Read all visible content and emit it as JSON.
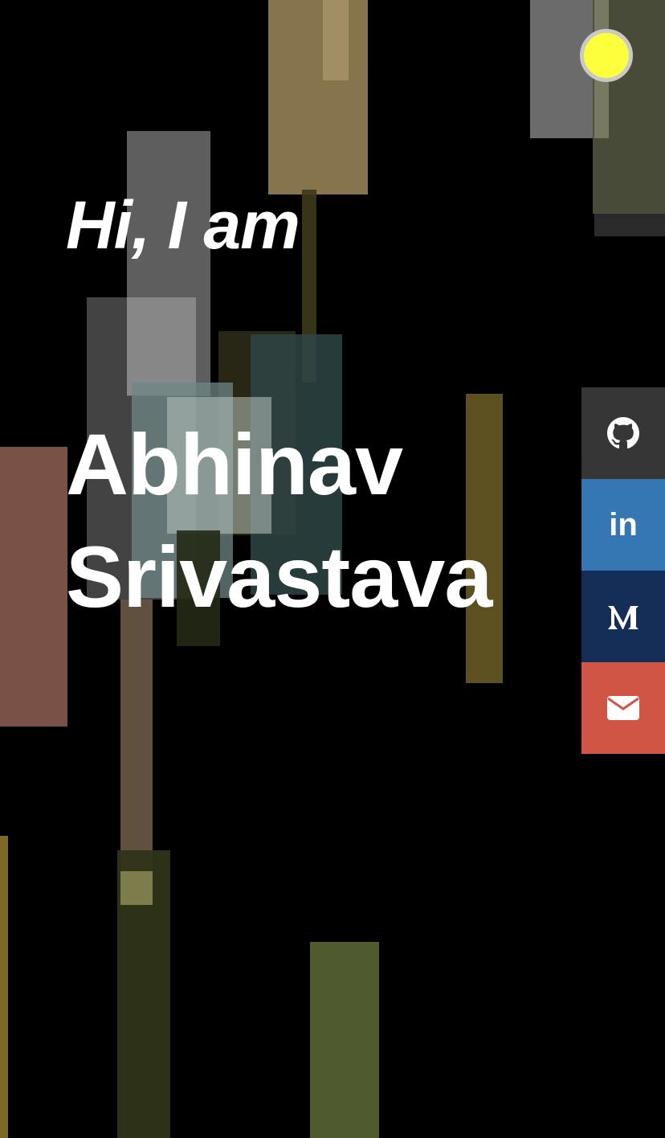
{
  "hero": {
    "greeting": "Hi, I am",
    "name_line1": "Abhinav",
    "name_line2": "Srivastava"
  },
  "theme_toggle": {
    "icon": "circle-toggle-icon",
    "color": "#fdff3d"
  },
  "social_links": [
    {
      "name": "github",
      "icon": "github-icon",
      "color": "#363636"
    },
    {
      "name": "linkedin",
      "icon": "linkedin-icon",
      "label": "in",
      "color": "#3577b3"
    },
    {
      "name": "medium",
      "icon": "medium-icon",
      "color": "#142e57"
    },
    {
      "name": "email",
      "icon": "envelope-icon",
      "color": "#d15544"
    }
  ],
  "background_colors": [
    "#000000",
    "#8c7a50",
    "#6b6b6b",
    "#7a5146",
    "#5d5020",
    "#4f5b2f",
    "#2e4545"
  ]
}
